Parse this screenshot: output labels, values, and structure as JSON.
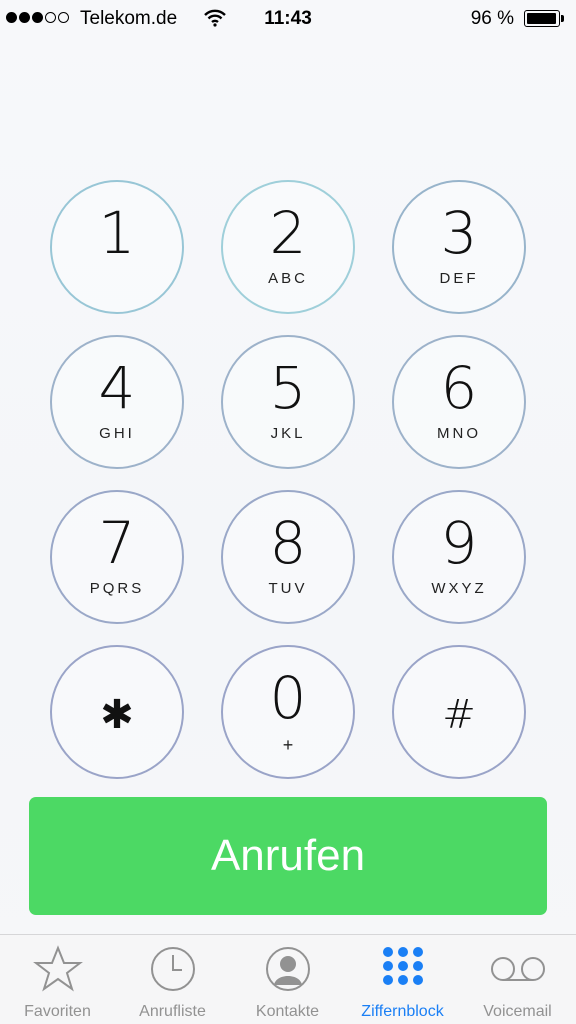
{
  "status_bar": {
    "signal_bars_filled": 3,
    "signal_bars_total": 5,
    "carrier": "Telekom.de",
    "time": "11:43",
    "battery_percent_text": "96 %",
    "battery_level": 0.96
  },
  "keypad": {
    "keys": [
      {
        "digit": "1",
        "letters": ""
      },
      {
        "digit": "2",
        "letters": "ABC"
      },
      {
        "digit": "3",
        "letters": "DEF"
      },
      {
        "digit": "4",
        "letters": "GHI"
      },
      {
        "digit": "5",
        "letters": "JKL"
      },
      {
        "digit": "6",
        "letters": "MNO"
      },
      {
        "digit": "7",
        "letters": "PQRS"
      },
      {
        "digit": "8",
        "letters": "TUV"
      },
      {
        "digit": "9",
        "letters": "WXYZ"
      },
      {
        "digit": "✱",
        "letters": ""
      },
      {
        "digit": "0",
        "letters": "+"
      },
      {
        "digit": "#",
        "letters": ""
      }
    ]
  },
  "call_button": {
    "label": "Anrufen",
    "color": "#4cd964"
  },
  "tab_bar": {
    "active_color": "#1a7ff5",
    "inactive_color": "#929292",
    "tabs": [
      {
        "label": "Favoriten",
        "icon": "star-icon",
        "active": false
      },
      {
        "label": "Anrufliste",
        "icon": "clock-icon",
        "active": false
      },
      {
        "label": "Kontakte",
        "icon": "contact-icon",
        "active": false
      },
      {
        "label": "Ziffernblock",
        "icon": "keypad-icon",
        "active": true
      },
      {
        "label": "Voicemail",
        "icon": "voicemail-icon",
        "active": false
      }
    ]
  }
}
